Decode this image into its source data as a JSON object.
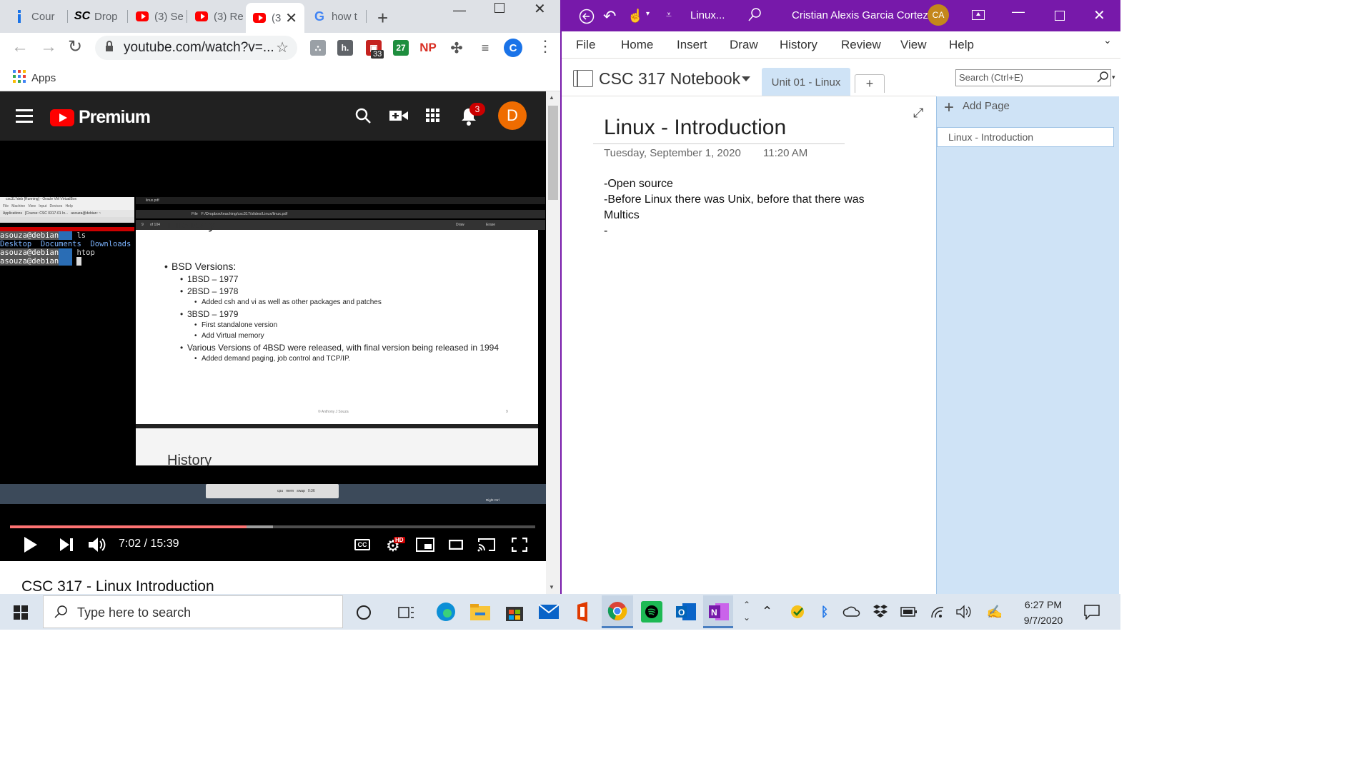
{
  "chrome": {
    "tabs": [
      {
        "label": "Cour",
        "icon": "info-icon"
      },
      {
        "label": "Drop",
        "icon": "sc-icon"
      },
      {
        "label": "(3) Se",
        "icon": "youtube-icon"
      },
      {
        "label": "(3) Re",
        "icon": "youtube-icon"
      },
      {
        "label": "(3",
        "icon": "youtube-icon",
        "active": true
      },
      {
        "label": "how t",
        "icon": "google-icon"
      }
    ],
    "url": "youtube.com/watch?v=...",
    "ext_badge": "33",
    "ext_calendar": "27",
    "ext_np": "NP",
    "ext_h": "h.",
    "profile_initial": "C",
    "bookmarks": {
      "apps_label": "Apps"
    }
  },
  "youtube": {
    "logo_text": "Premium",
    "notification_count": "3",
    "avatar_initial": "D",
    "time": "7:02 / 15:39",
    "progress_played": 0.45,
    "video_title": "CSC 317 - Linux Introduction",
    "hd_badge": "HD",
    "cc_label": "CC"
  },
  "video": {
    "vm_title": "csc317deb [Running] - Oracle VM VirtualBox",
    "vm_menu": "File   Machine   View   Input   Devices   Help",
    "vm_taskbar": "Applications",
    "vm_tab": "[Course: CSC 0317-01 In...",
    "vm_tab2": "asouza@debian: ~",
    "terminal": {
      "lines": [
        {
          "prompt": "asouza@debian",
          "cmd": "ls"
        },
        {
          "output": "Desktop  Documents  Downloads  M"
        },
        {
          "prompt": "asouza@debian",
          "cmd": "htop"
        },
        {
          "prompt": "asouza@debian",
          "cmd": ""
        }
      ]
    },
    "pdf_tab": "linux.pdf",
    "pdf_path": "File   F:/Dropbox/teaching/csc317/slides/Linux/linux.pdf",
    "pdf_page": "9",
    "pdf_of": "of 104",
    "pdf_draw": "Draw",
    "pdf_erase": "Erase",
    "slide": {
      "title": "History",
      "items": [
        {
          "level": 1,
          "text": "BSD Versions:"
        },
        {
          "level": 2,
          "text": "1BSD – 1977"
        },
        {
          "level": 2,
          "text": "2BSD – 1978"
        },
        {
          "level": 3,
          "text": "Added csh and vi as well as other packages and patches"
        },
        {
          "level": 2,
          "text": "3BSD – 1979"
        },
        {
          "level": 3,
          "text": "First standalone version"
        },
        {
          "level": 3,
          "text": "Add Virtual memory"
        },
        {
          "level": 2,
          "text": "Various Versions of 4BSD were released, with final version being released in 1994"
        },
        {
          "level": 3,
          "text": "Added demand paging, job control and TCP/IP."
        }
      ],
      "footer": "© Anthony J Souza",
      "page_num": "9",
      "next_title": "History"
    },
    "vm_dock": {
      "cpu": "cpu",
      "mem": "mem",
      "swap": "swap",
      "clock": "0:36"
    },
    "host_key": "Right Ctrl"
  },
  "onenote": {
    "title": "Linux...",
    "user": "Cristian Alexis Garcia Cortez",
    "user_initials": "CA",
    "menu": [
      "File",
      "Home",
      "Insert",
      "Draw",
      "History",
      "Review",
      "View",
      "Help"
    ],
    "notebook": "CSC 317 Notebook",
    "section_tab": "Unit 01 - Linux",
    "search_placeholder": "Search (Ctrl+E)",
    "add_page": "Add Page",
    "pages": [
      "Linux - Introduction"
    ],
    "page_title": "Linux - Introduction",
    "date": "Tuesday, September 1, 2020",
    "time": "11:20 AM",
    "note_lines": [
      "-Open source",
      "-Before Linux there was Unix, before that there was",
      "Multics",
      "-"
    ]
  },
  "taskbar": {
    "search_placeholder": "Type here to search",
    "clock_time": "6:27 PM",
    "clock_date": "9/7/2020"
  },
  "colors": {
    "youtube_red": "#ff0000",
    "onenote_purple": "#7719aa",
    "page_panel": "#cfe3f6"
  }
}
